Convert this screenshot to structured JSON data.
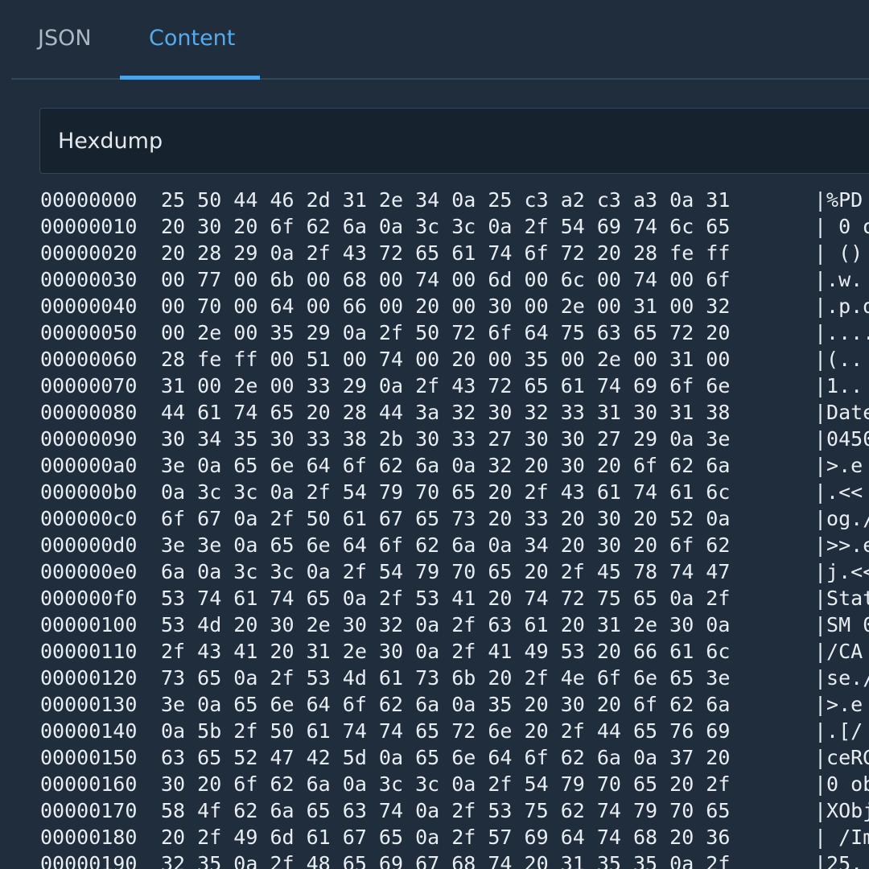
{
  "tabs": [
    {
      "label": "JSON"
    },
    {
      "label": "Content"
    }
  ],
  "selector": {
    "label": "Hexdump"
  },
  "hexdump": {
    "rows": [
      {
        "offset": "00000000",
        "bytes": "25 50 44 46 2d 31 2e 34 0a 25 c3 a2 c3 a3 0a 31",
        "ascii": "|%PD"
      },
      {
        "offset": "00000010",
        "bytes": "20 30 20 6f 62 6a 0a 3c 3c 0a 2f 54 69 74 6c 65",
        "ascii": "| 0 o"
      },
      {
        "offset": "00000020",
        "bytes": "20 28 29 0a 2f 43 72 65 61 74 6f 72 20 28 fe ff",
        "ascii": "| ()"
      },
      {
        "offset": "00000030",
        "bytes": "00 77 00 6b 00 68 00 74 00 6d 00 6c 00 74 00 6f",
        "ascii": "|.w."
      },
      {
        "offset": "00000040",
        "bytes": "00 70 00 64 00 66 00 20 00 30 00 2e 00 31 00 32",
        "ascii": "|.p.d"
      },
      {
        "offset": "00000050",
        "bytes": "00 2e 00 35 29 0a 2f 50 72 6f 64 75 63 65 72 20",
        "ascii": "|...."
      },
      {
        "offset": "00000060",
        "bytes": "28 fe ff 00 51 00 74 00 20 00 35 00 2e 00 31 00",
        "ascii": "|(.."
      },
      {
        "offset": "00000070",
        "bytes": "31 00 2e 00 33 29 0a 2f 43 72 65 61 74 69 6f 6e",
        "ascii": "|1.."
      },
      {
        "offset": "00000080",
        "bytes": "44 61 74 65 20 28 44 3a 32 30 32 33 31 30 31 38",
        "ascii": "|Date"
      },
      {
        "offset": "00000090",
        "bytes": "30 34 35 30 33 38 2b 30 33 27 30 30 27 29 0a 3e",
        "ascii": "|0450"
      },
      {
        "offset": "000000a0",
        "bytes": "3e 0a 65 6e 64 6f 62 6a 0a 32 20 30 20 6f 62 6a",
        "ascii": "|>.e"
      },
      {
        "offset": "000000b0",
        "bytes": "0a 3c 3c 0a 2f 54 79 70 65 20 2f 43 61 74 61 6c",
        "ascii": "|.<<"
      },
      {
        "offset": "000000c0",
        "bytes": "6f 67 0a 2f 50 61 67 65 73 20 33 20 30 20 52 0a",
        "ascii": "|og./"
      },
      {
        "offset": "000000d0",
        "bytes": "3e 3e 0a 65 6e 64 6f 62 6a 0a 34 20 30 20 6f 62",
        "ascii": "|>>.e"
      },
      {
        "offset": "000000e0",
        "bytes": "6a 0a 3c 3c 0a 2f 54 79 70 65 20 2f 45 78 74 47",
        "ascii": "|j.<<"
      },
      {
        "offset": "000000f0",
        "bytes": "53 74 61 74 65 0a 2f 53 41 20 74 72 75 65 0a 2f",
        "ascii": "|Stat"
      },
      {
        "offset": "00000100",
        "bytes": "53 4d 20 30 2e 30 32 0a 2f 63 61 20 31 2e 30 0a",
        "ascii": "|SM 0"
      },
      {
        "offset": "00000110",
        "bytes": "2f 43 41 20 31 2e 30 0a 2f 41 49 53 20 66 61 6c",
        "ascii": "|/CA"
      },
      {
        "offset": "00000120",
        "bytes": "73 65 0a 2f 53 4d 61 73 6b 20 2f 4e 6f 6e 65 3e",
        "ascii": "|se./"
      },
      {
        "offset": "00000130",
        "bytes": "3e 0a 65 6e 64 6f 62 6a 0a 35 20 30 20 6f 62 6a",
        "ascii": "|>.e"
      },
      {
        "offset": "00000140",
        "bytes": "0a 5b 2f 50 61 74 74 65 72 6e 20 2f 44 65 76 69",
        "ascii": "|.[/"
      },
      {
        "offset": "00000150",
        "bytes": "63 65 52 47 42 5d 0a 65 6e 64 6f 62 6a 0a 37 20",
        "ascii": "|ceRG"
      },
      {
        "offset": "00000160",
        "bytes": "30 20 6f 62 6a 0a 3c 3c 0a 2f 54 79 70 65 20 2f",
        "ascii": "|0 ob"
      },
      {
        "offset": "00000170",
        "bytes": "58 4f 62 6a 65 63 74 0a 2f 53 75 62 74 79 70 65",
        "ascii": "|XObj"
      },
      {
        "offset": "00000180",
        "bytes": "20 2f 49 6d 61 67 65 0a 2f 57 69 64 74 68 20 36",
        "ascii": "| /Im"
      },
      {
        "offset": "00000190",
        "bytes": "32 35 0a 2f 48 65 69 67 68 74 20 31 35 35 0a 2f",
        "ascii": "|25."
      }
    ]
  },
  "colors": {
    "background": "#1f2d3d",
    "active_tab": "#56abec",
    "inactive_tab": "#aeb8c4",
    "selector_bg": "#17222f",
    "text": "#e8edf2"
  }
}
